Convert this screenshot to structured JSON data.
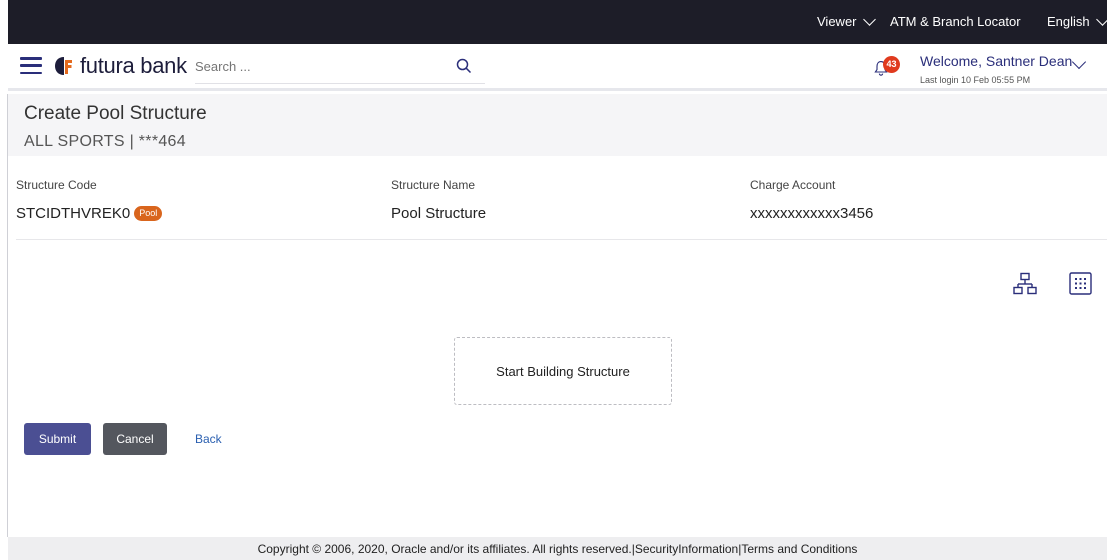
{
  "topbar": {
    "role": "Viewer",
    "atm_locator": "ATM & Branch Locator",
    "language": "English"
  },
  "header": {
    "brand": "futura bank",
    "search_placeholder": "Search ...",
    "notification_count": "43",
    "welcome": "Welcome, Santner Dean",
    "last_login": "Last login 10 Feb 05:55 PM"
  },
  "page": {
    "title": "Create Pool Structure",
    "subtitle": "ALL SPORTS | ***464"
  },
  "details": {
    "structure_code_label": "Structure Code",
    "structure_code_value": "STCIDTHVREK0",
    "structure_code_tag": "Pool",
    "structure_name_label": "Structure Name",
    "structure_name_value": "Pool Structure",
    "charge_account_label": "Charge Account",
    "charge_account_value": "xxxxxxxxxxxx3456"
  },
  "builder": {
    "start_label": "Start Building Structure"
  },
  "actions": {
    "submit": "Submit",
    "cancel": "Cancel",
    "back": "Back"
  },
  "footer": {
    "text": "Copyright © 2006, 2020, Oracle and/or its affiliates. All rights reserved.|SecurityInformation|Terms and Conditions"
  },
  "colors": {
    "primary": "#4b4f93",
    "brand_navy": "#2a2e7a",
    "accent_orange": "#d9651d",
    "topbar": "#1d1d28"
  },
  "icons": [
    "menu-icon",
    "search-icon",
    "bell-icon",
    "chevron-down-icon",
    "tree-view-icon",
    "grid-view-icon"
  ]
}
